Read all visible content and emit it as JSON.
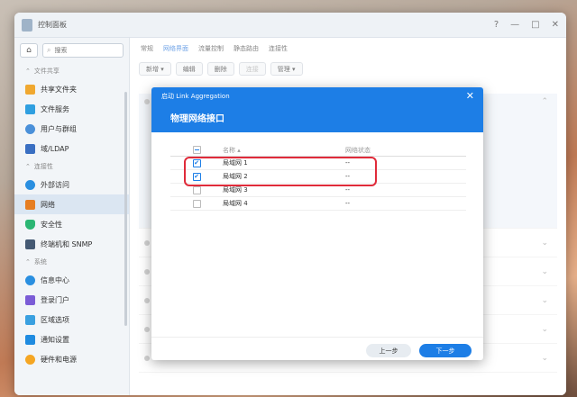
{
  "window": {
    "title": "控制面板"
  },
  "sidebar": {
    "search_placeholder": "搜索",
    "sections": [
      {
        "label": "文件共享",
        "items": [
          "共享文件夹",
          "文件服务",
          "用户与群组",
          "域/LDAP"
        ]
      },
      {
        "label": "连接性",
        "items": [
          "外部访问",
          "网络",
          "安全性",
          "终端机和 SNMP"
        ]
      },
      {
        "label": "系统",
        "items": [
          "信息中心",
          "登录门户",
          "区域选项",
          "通知设置",
          "硬件和电源"
        ]
      }
    ]
  },
  "main": {
    "tabs": [
      "常规",
      "网络界面",
      "流量控制",
      "静态路由",
      "连接性"
    ],
    "active_tab": "网络界面",
    "toolbar": [
      "新增",
      "编辑",
      "删除",
      "连接",
      "管理"
    ]
  },
  "dialog": {
    "title": "启动 Link Aggregation",
    "subtitle": "物理网络接口",
    "columns": [
      "名称",
      "网络状态"
    ],
    "rows": [
      {
        "name": "局域网 1",
        "status": "--",
        "checked": true
      },
      {
        "name": "局域网 2",
        "status": "--",
        "checked": true
      },
      {
        "name": "局域网 3",
        "status": "--",
        "checked": false
      },
      {
        "name": "局域网 4",
        "status": "--",
        "checked": false
      }
    ],
    "prev_label": "上一步",
    "next_label": "下一步"
  }
}
